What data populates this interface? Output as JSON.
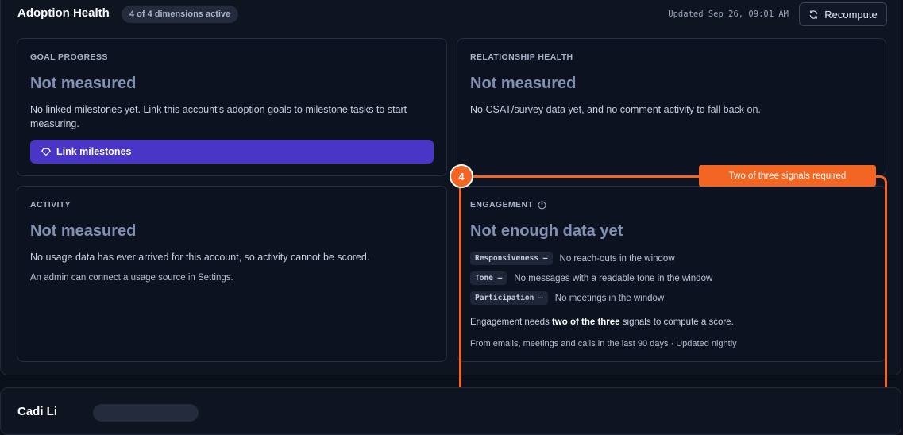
{
  "header": {
    "title": "Adoption Health",
    "badge": "4 of 4 dimensions active",
    "updated": "Updated Sep 26, 09:01 AM",
    "recompute_label": "Recompute"
  },
  "cards": {
    "goal": {
      "label": "GOAL PROGRESS",
      "value": "Not measured",
      "desc": "No linked milestones yet. Link this account's adoption goals to milestone tasks to start measuring.",
      "button": "Link milestones"
    },
    "relationship": {
      "label": "RELATIONSHIP HEALTH",
      "value": "Not measured",
      "desc": "No CSAT/survey data yet, and no comment activity to fall back on."
    },
    "activity": {
      "label": "ACTIVITY",
      "value": "Not measured",
      "desc": "No usage data has ever arrived for this account, so activity cannot be scored.",
      "note": "An admin can connect a usage source in Settings."
    },
    "engagement": {
      "label": "ENGAGEMENT",
      "value": "Not enough data yet",
      "signals": [
        {
          "chip": "Responsiveness —",
          "desc": "No reach-outs in the window"
        },
        {
          "chip": "Tone —",
          "desc": "No messages with a readable tone in the window"
        },
        {
          "chip": "Participation —",
          "desc": "No meetings in the window"
        }
      ],
      "needs_prefix": "Engagement needs ",
      "needs_bold": "two of the three",
      "needs_suffix": " signals to compute a score.",
      "footer": "From emails, meetings and calls in the last 90 days · Updated nightly"
    }
  },
  "annotation": {
    "number": "4",
    "tag": "Two of three signals required",
    "color": "#f26522"
  },
  "next_section": {
    "title": "Cadi Li"
  },
  "colors": {
    "background": "#0b0f1a",
    "accent": "#4a36c6",
    "value_text": "#8291b3"
  }
}
